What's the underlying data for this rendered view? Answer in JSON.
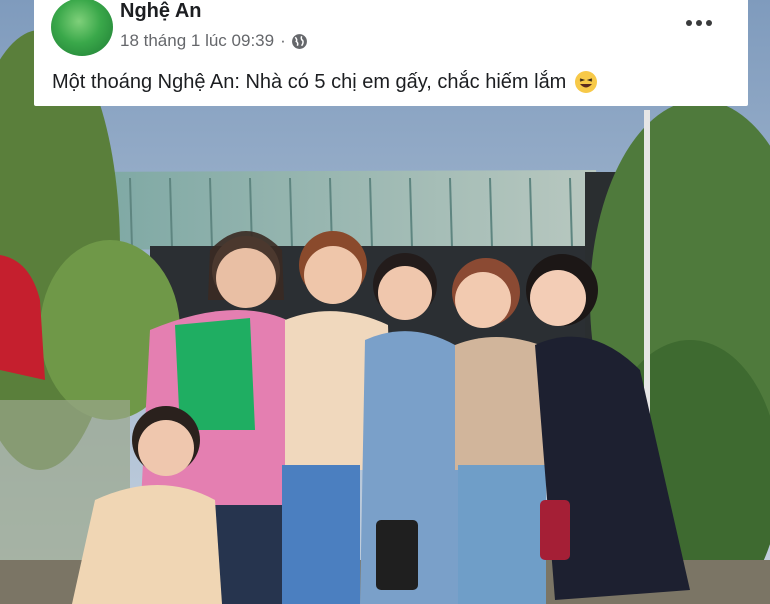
{
  "post": {
    "page_name": "Nghệ An",
    "timestamp": "18 tháng 1 lúc 09:39",
    "separator": "·",
    "privacy_icon": "globe-icon",
    "more_icon": "more-options-icon",
    "text": "Một thoáng Nghệ An: Nhà có 5 chị em gấy, chắc hiếm lắm",
    "emoji": "laughing-emoji-icon"
  },
  "colors": {
    "header_bg": "#ffffff",
    "name_text": "#1c1e21",
    "meta_text": "#65676b",
    "avatar_green": "#3aa84a"
  }
}
